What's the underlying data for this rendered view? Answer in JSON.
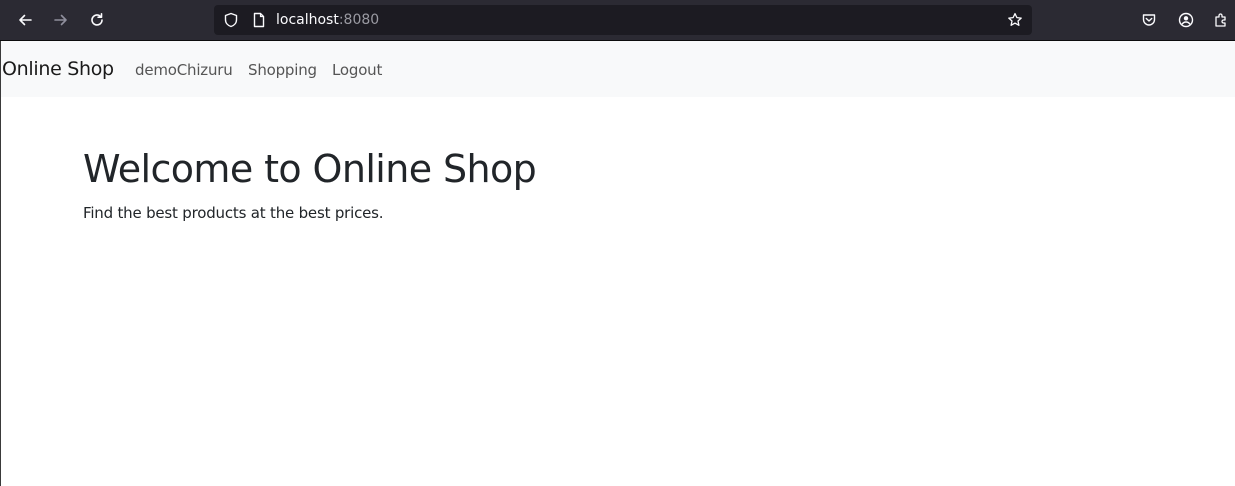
{
  "browser": {
    "url_host": "localhost",
    "url_port": ":8080",
    "icons": {
      "back": "arrow-left-icon",
      "forward": "arrow-right-icon",
      "reload": "reload-icon",
      "tracking": "shield-icon",
      "page_info": "page-icon",
      "bookmark": "star-icon",
      "pocket": "pocket-icon",
      "account": "account-icon",
      "extensions": "extensions-icon"
    }
  },
  "navbar": {
    "brand": "Online Shop",
    "links": [
      {
        "label": "demoChizuru"
      },
      {
        "label": "Shopping"
      },
      {
        "label": "Logout"
      }
    ]
  },
  "hero": {
    "title": "Welcome to Online Shop",
    "subtitle": "Find the best products at the best prices."
  },
  "colors": {
    "chrome_bg": "#2b2a33",
    "urlbar_bg": "#1c1b22",
    "navbar_bg": "#f8f9fa",
    "text_dark": "#212529",
    "nav_link": "#555555"
  }
}
